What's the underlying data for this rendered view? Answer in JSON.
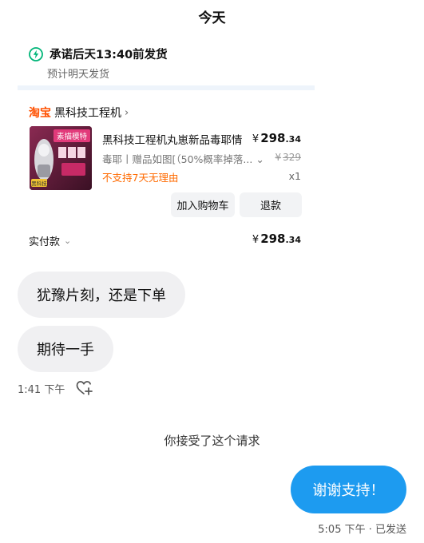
{
  "date_header": "今天",
  "order": {
    "shipping_promise": "承诺后天13:40前发货",
    "shipping_estimate": "预计明天发货",
    "shop_logo": "淘宝",
    "shop_name": "黑科技工程机",
    "shop_chevron": "›",
    "product": {
      "thumbnail_text": "素描模特",
      "thumbnail_corner": "黑科技",
      "title": "黑科技工程机丸崽新品毒耶情",
      "variant": "毒耶丨赠品如图[（50%概率掉落...",
      "variant_chevron": "⌄",
      "policy": "不支持7天无理由",
      "price_symbol": "¥",
      "price_int": "298",
      "price_dec": ".34",
      "original_price": "329",
      "quantity": "x1"
    },
    "add_to_cart_label": "加入购物车",
    "refund_label": "退款",
    "paid_label": "实付款",
    "paid_chevron": "⌄",
    "paid_symbol": "¥",
    "paid_int": "298",
    "paid_dec": ".34"
  },
  "messages": {
    "received": [
      "犹豫片刻，还是下单",
      "期待一手"
    ],
    "received_time": "1:41 下午",
    "system_note": "你接受了这个请求",
    "sent": "谢谢支持！",
    "sent_meta": "5:05 下午 · 已发送"
  },
  "colors": {
    "accent_blue": "#1d9bf0",
    "taobao_orange": "#ff5000",
    "policy_orange": "#ff6a00",
    "bolt_green": "#00b578"
  },
  "icons": {
    "shipping": "lightning-bolt-icon",
    "react": "heart-plus-icon"
  }
}
